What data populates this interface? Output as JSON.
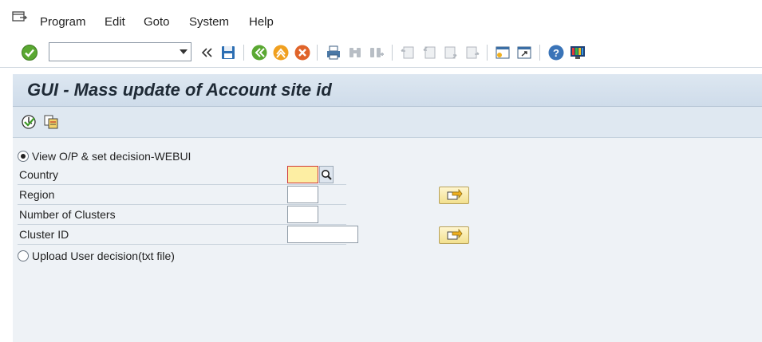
{
  "menu": {
    "items": [
      {
        "label": "Program"
      },
      {
        "label": "Edit"
      },
      {
        "label": "Goto"
      },
      {
        "label": "System"
      },
      {
        "label": "Help"
      }
    ]
  },
  "toolbar": {
    "command_field": {
      "value": "",
      "placeholder": ""
    }
  },
  "page": {
    "title": "GUI - Mass update of Account site id"
  },
  "form": {
    "option1": {
      "label": "View O/P & set decision-WEBUI",
      "selected": true
    },
    "fields": [
      {
        "label": "Country",
        "value": ""
      },
      {
        "label": "Region",
        "value": ""
      },
      {
        "label": "Number of Clusters",
        "value": ""
      },
      {
        "label": "Cluster ID",
        "value": ""
      }
    ],
    "option2": {
      "label": "Upload User decision(txt file)",
      "selected": false
    }
  },
  "colors": {
    "title_band": "#cfdcea",
    "content_bg": "#eef2f6",
    "focus_field": "#fdeea3"
  }
}
